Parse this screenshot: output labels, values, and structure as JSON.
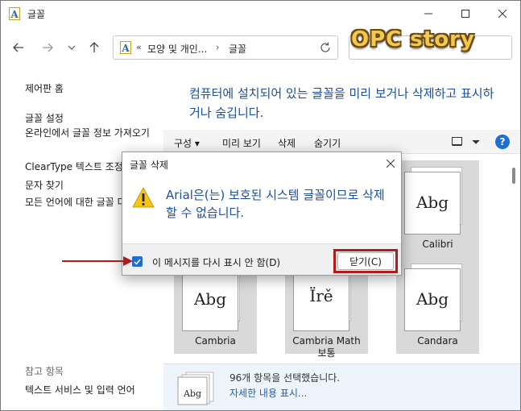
{
  "window": {
    "title": "글꼴",
    "controls": [
      "minimize",
      "maximize",
      "close"
    ]
  },
  "nav": {
    "back_icon": "back-arrow-icon",
    "forward_icon": "forward-arrow-icon",
    "recent_icon": "chevron-down-icon",
    "up_icon": "up-arrow-icon"
  },
  "address": {
    "overflow": "«",
    "crumbs": [
      "모양 및 개인...",
      "글꼴"
    ],
    "separator": "›"
  },
  "watermark": "OPC story",
  "sidebar": {
    "items": [
      "제어판 홈",
      "글꼴 설정",
      "온라인에서 글꼴 정보 가져오기",
      "ClearType 텍스트 조정",
      "문자 찾기",
      "모든 언어에 대한 글꼴 다운로드"
    ],
    "see_also_heading": "참고 항목",
    "see_also_items": [
      "텍스트 서비스 및 입력 언어"
    ]
  },
  "description": "컴퓨터에 설치되어 있는 글꼴을 미리 보거나 삭제하고 표시하거나 숨깁니다.",
  "toolbar": {
    "organize": "구성 ▾",
    "preview": "미리 보기",
    "delete": "삭제",
    "hide": "숨기기",
    "help": "?"
  },
  "fonts": [
    {
      "name": "Calibri",
      "sample": "Abg"
    },
    {
      "name": "Cambria",
      "sample": "Abg"
    },
    {
      "name": "Cambria Math 보통",
      "sample": "Ïrě"
    },
    {
      "name": "Candara",
      "sample": "Abg"
    }
  ],
  "status": {
    "count": "96개 항목을 선택했습니다.",
    "details_link": "자세한 내용 표시...",
    "thumb_sample": "Abg"
  },
  "dialog": {
    "title": "글꼴 삭제",
    "message": "Arial은(는) 보호된 시스템 글꼴이므로 삭제할 수 없습니다.",
    "checkbox_label": "이 메시지를 다시 표시 안 함(D)",
    "checkbox_checked": true,
    "close_button": "닫기(C)"
  },
  "colors": {
    "accent": "#1f6fd1",
    "description_text": "#1c4e9c",
    "annotation_red": "#b01c1c",
    "warning_yellow": "#f5c518"
  }
}
